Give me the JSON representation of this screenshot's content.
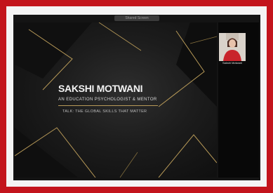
{
  "app": {
    "toolbar_label": "Shared Screen"
  },
  "slide": {
    "title": "SAKSHI MOTWANI",
    "subtitle": "AN EDUCATION PSYCHOLOGIST & MENTOR",
    "caption": "TALK: THE GLOBAL SKILLS THAT MATTER"
  },
  "participant": {
    "name": "Sakshi Motwani",
    "icon": "user-video-thumbnail"
  },
  "colors": {
    "frame": "#c3141c",
    "slide_bg": "#141414",
    "accent_gold": "#b89a58",
    "title_text": "#f2f2f2"
  }
}
